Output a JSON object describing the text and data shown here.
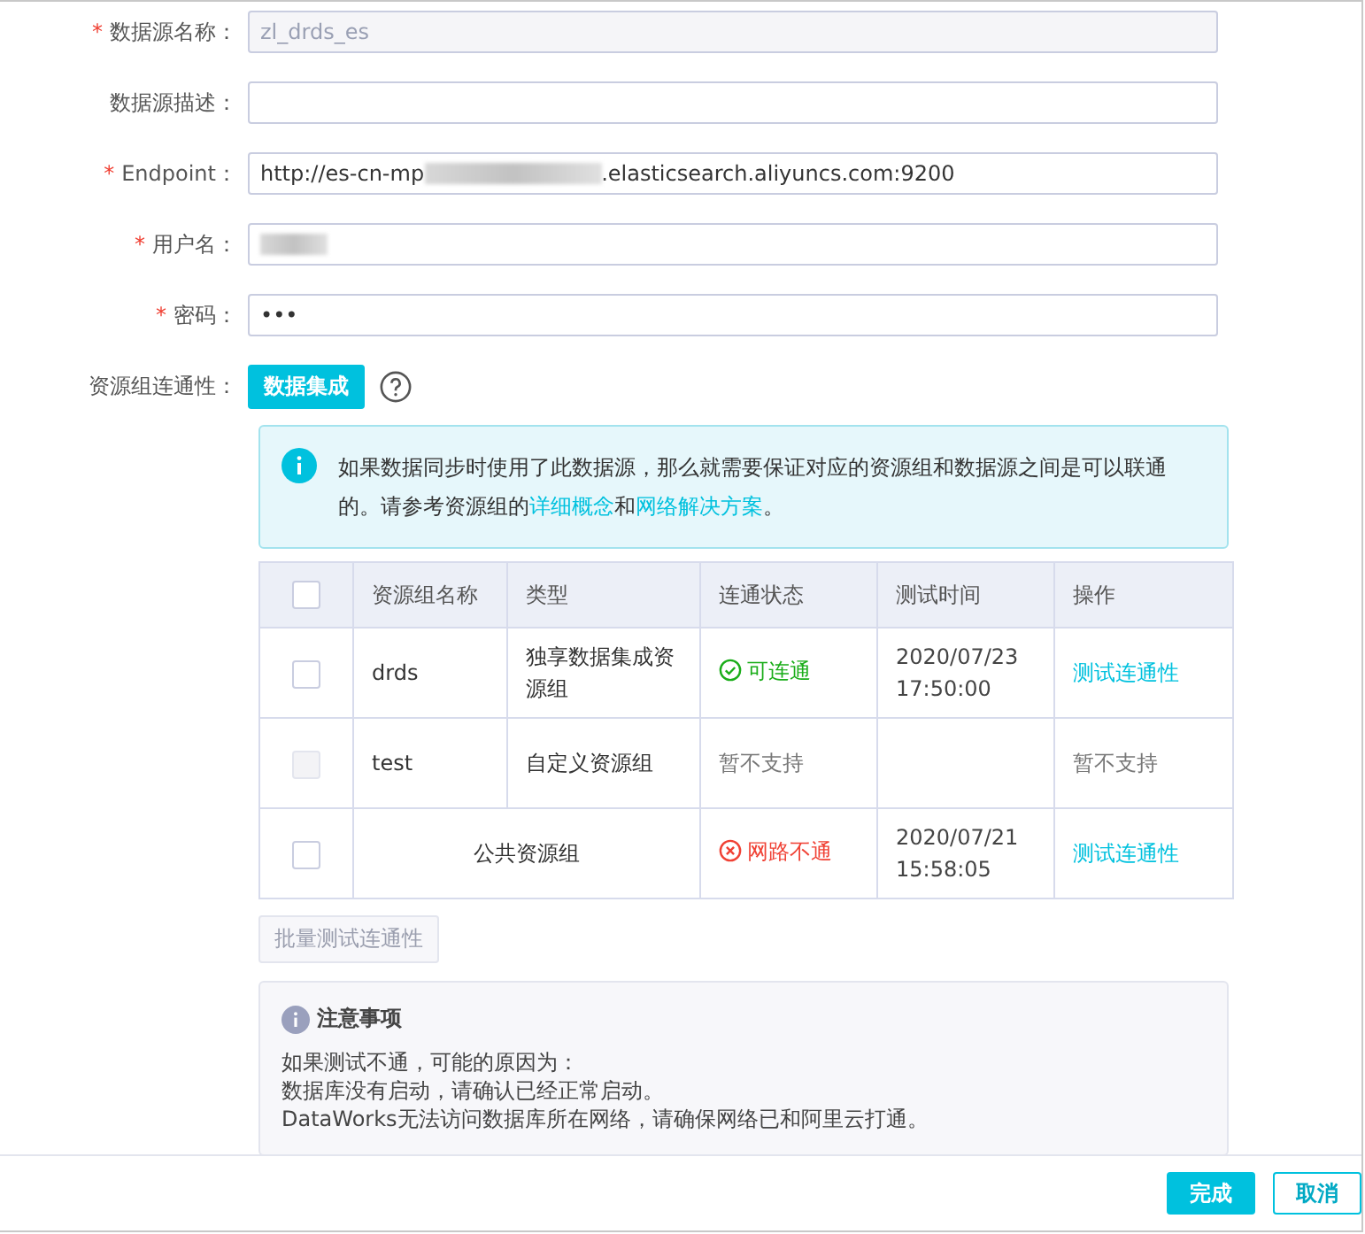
{
  "form": {
    "fields": [
      {
        "label": "数据源名称：",
        "required_mark": "*",
        "kind": "text",
        "value": "zl_drds_es",
        "disabled": true
      },
      {
        "label": "数据源描述：",
        "kind": "text"
      },
      {
        "label": "Endpoint：",
        "required_mark": "*",
        "kind": "redacted",
        "value": "http://es-cn-mp",
        "value_end": ".elasticsearch.aliyuncs.com:9200"
      },
      {
        "label": "用户名：",
        "required_mark": "*",
        "kind": "redacted"
      },
      {
        "label": "密码：",
        "required_mark": "*",
        "kind": "password",
        "value": "•••"
      }
    ]
  },
  "connectivity": {
    "label": "资源组连通性：",
    "tag": "数据集成",
    "info": {
      "text": "如果数据同步时使用了此数据源，那么就需要保证对应的资源组和数据源之间是可以联通的。请参考资源组的",
      "link1": "详细概念",
      "middle": "和",
      "link2": "网络解决方案",
      "end": "。"
    },
    "table": {
      "header_checked": false,
      "columns": [
        "资源组名称",
        "类型",
        "连通状态",
        "测试时间",
        "操作"
      ],
      "rows": [
        {
          "checked": false,
          "disabled": false,
          "name": "drds",
          "type": "独享数据集成资源组",
          "status": {
            "text": "可连通",
            "kind": "ok"
          },
          "time": "2020/07/23 17:50:00",
          "action": {
            "text": "测试连通性",
            "kind": "link"
          }
        },
        {
          "checked": false,
          "disabled": true,
          "name": "test",
          "type": "自定义资源组",
          "status": {
            "text": "暂不支持",
            "kind": "none"
          },
          "action": {
            "text": "暂不支持",
            "kind": "plain"
          }
        },
        {
          "checked": false,
          "disabled": false,
          "type": "公共资源组",
          "status": {
            "text": "网路不通",
            "kind": "fail"
          },
          "time": "2020/07/21 15:58:05",
          "action": {
            "text": "测试连通性",
            "kind": "link"
          }
        }
      ]
    },
    "batch_button": {
      "label": "批量测试连通性",
      "disabled": true
    },
    "notes": {
      "title": "注意事项",
      "lines": [
        "如果测试不通，可能的原因为：",
        "数据库没有启动，请确认已经正常启动。",
        "DataWorks无法访问数据库所在网络，请确保网络已和阿里云打通。"
      ]
    }
  },
  "footer": {
    "buttons": [
      {
        "label": "完成",
        "kind": "primary"
      },
      {
        "label": "取消",
        "kind": "secondary"
      }
    ]
  }
}
